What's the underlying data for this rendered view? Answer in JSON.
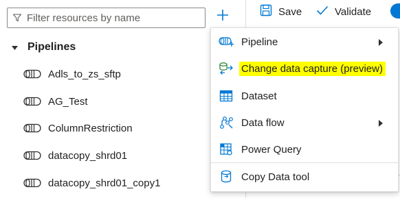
{
  "filter": {
    "placeholder": "Filter resources by name"
  },
  "toolbar": {
    "save_label": "Save",
    "validate_label": "Validate",
    "accent": "#0078d4"
  },
  "section": {
    "title": "Pipelines"
  },
  "pipelines": [
    {
      "label": "Adls_to_zs_sftp"
    },
    {
      "label": "AG_Test"
    },
    {
      "label": "ColumnRestriction"
    },
    {
      "label": "datacopy_shrd01"
    },
    {
      "label": "datacopy_shrd01_copy1"
    }
  ],
  "menu": {
    "items": [
      {
        "label": "Pipeline",
        "icon": "pipeline-icon",
        "has_submenu": true
      },
      {
        "label": "Change data capture (preview)",
        "icon": "change-data-capture-icon",
        "highlighted": true,
        "highlight_color": "#ffff00"
      },
      {
        "label": "Dataset",
        "icon": "dataset-icon"
      },
      {
        "label": "Data flow",
        "icon": "data-flow-icon",
        "has_submenu": true
      },
      {
        "label": "Power Query",
        "icon": "power-query-icon"
      },
      {
        "label": "Copy Data tool",
        "icon": "copy-data-tool-icon"
      }
    ]
  }
}
